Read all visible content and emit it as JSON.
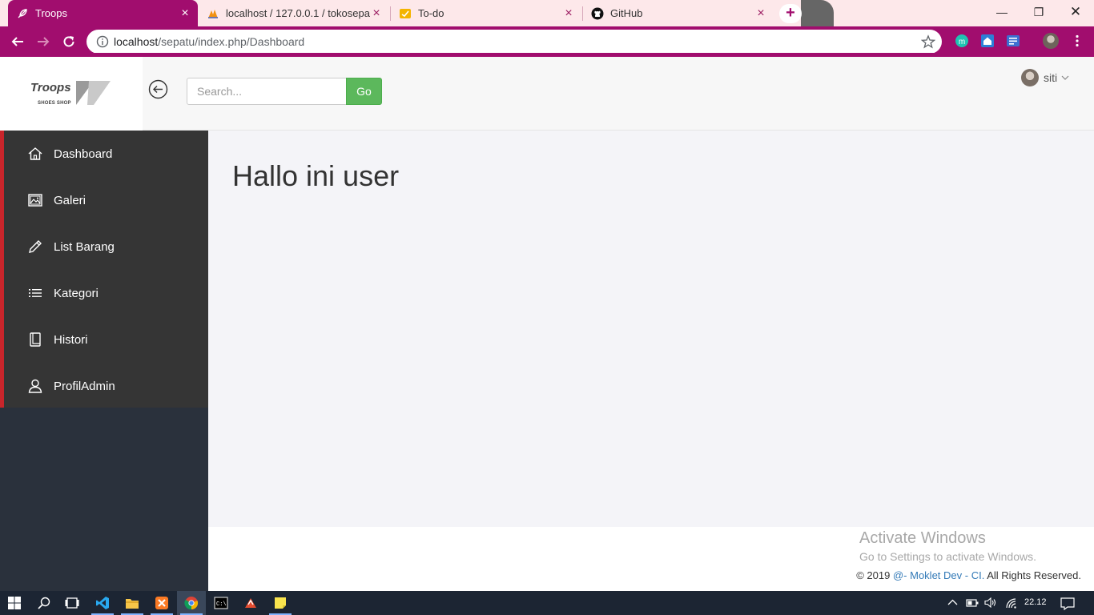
{
  "browser": {
    "tabs": [
      {
        "title": "Troops",
        "active": true
      },
      {
        "title": "localhost / 127.0.0.1 / tokosepatu",
        "active": false
      },
      {
        "title": "To-do",
        "active": false
      },
      {
        "title": "GitHub",
        "active": false
      }
    ],
    "url_host": "localhost",
    "url_path": "/sepatu/index.php/Dashboard",
    "accent_color": "#a10d6e"
  },
  "header": {
    "brand": "Troops",
    "brand_sub": "SHOES SHOP",
    "search_placeholder": "Search...",
    "search_button": "Go",
    "username": "siti"
  },
  "sidebar": {
    "items": [
      {
        "label": "Dashboard",
        "icon": "home-icon"
      },
      {
        "label": "Galeri",
        "icon": "image-icon"
      },
      {
        "label": "List Barang",
        "icon": "pencil-icon"
      },
      {
        "label": "Kategori",
        "icon": "list-icon"
      },
      {
        "label": "Histori",
        "icon": "book-icon"
      },
      {
        "label": "ProfilAdmin",
        "icon": "user-icon"
      }
    ],
    "active_border_color": "#c8252b"
  },
  "main": {
    "title": "Hallo ini user"
  },
  "footer": {
    "copyright_prefix": "© 2019",
    "copyright_link": "@- Moklet Dev - CI.",
    "copyright_suffix": "All Rights Reserved.",
    "watermark_title": "Activate Windows",
    "watermark_sub": "Go to Settings to activate Windows."
  },
  "taskbar": {
    "clock": "22.12"
  }
}
